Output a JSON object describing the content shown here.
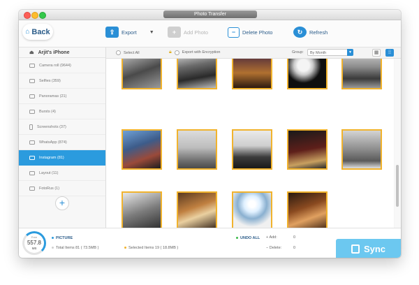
{
  "window": {
    "title": "Photo Transfer"
  },
  "toolbar": {
    "back_label": "Back",
    "export_label": "Export",
    "add_photo_label": "Add Photo",
    "delete_photo_label": "Delete Photo",
    "refresh_label": "Refresh"
  },
  "sidebar": {
    "device_name": "Arjit's iPhone",
    "items": [
      {
        "label": "Camera roll (9644)",
        "icon": "camera-icon",
        "active": false
      },
      {
        "label": "Selfies (359)",
        "icon": "selfie-icon",
        "active": false
      },
      {
        "label": "Panoramas (21)",
        "icon": "panorama-icon",
        "active": false
      },
      {
        "label": "Bursts (4)",
        "icon": "burst-icon",
        "active": false
      },
      {
        "label": "Screenshots (37)",
        "icon": "screenshot-icon",
        "active": false
      },
      {
        "label": "WhatsApp (874)",
        "icon": "album-icon",
        "active": false
      },
      {
        "label": "Instagram (81)",
        "icon": "album-icon",
        "active": true
      },
      {
        "label": "Layout (11)",
        "icon": "album-icon",
        "active": false
      },
      {
        "label": "FotoRus (1)",
        "icon": "album-icon",
        "active": false
      }
    ]
  },
  "options": {
    "select_all_label": "Select All",
    "export_encryption_label": "Export with Encryption",
    "group_label": "Group:",
    "group_value": "By Month"
  },
  "photos": {
    "count_shown": 19,
    "rows": [
      5,
      5,
      4
    ],
    "border_color": "#f1b32d"
  },
  "status": {
    "free_label": "Free",
    "free_value": "557.8",
    "free_unit": "MB",
    "category_label": "PICTURE",
    "total_items": "Total Items 81 ( 73.5MB )",
    "selected_items": "Selected Items 19 ( 18.8MB )",
    "undo_all_label": "UNDO ALL",
    "add_label": "Add:",
    "add_value": "0",
    "delete_label": "Delete:",
    "delete_value": "0",
    "sync_label": "Sync"
  },
  "colors": {
    "accent": "#2b9bde",
    "selection_border": "#f1b32d",
    "sync_button": "#6cc8f0",
    "undo_dot": "#3dbb4a"
  }
}
